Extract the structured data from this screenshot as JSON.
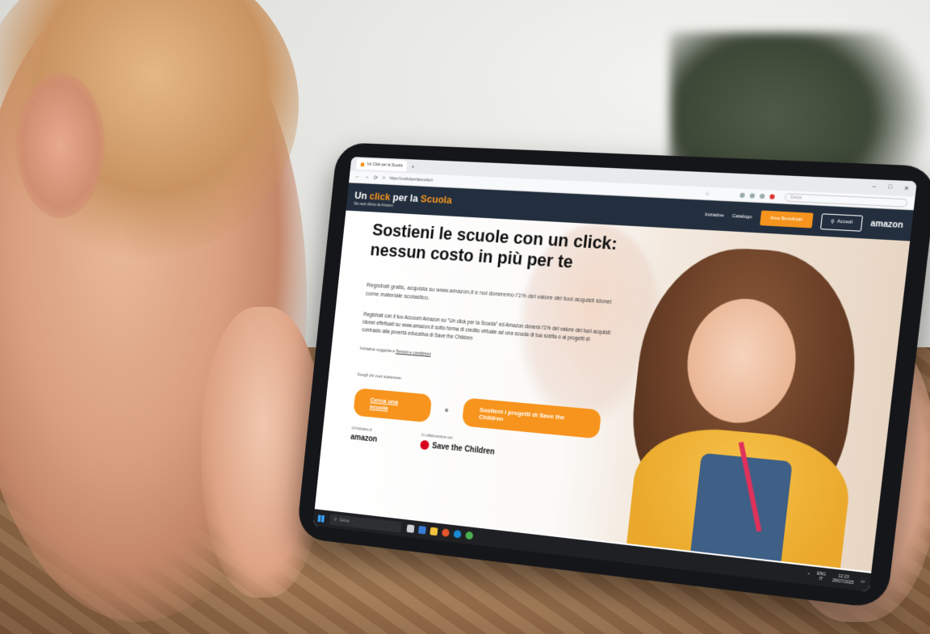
{
  "browser": {
    "tab_title": "Un Click per la Scuola",
    "tab_plus": "+",
    "url": "https://unclickperlascuola.it",
    "search_placeholder": "Cerca",
    "window_controls": [
      "–",
      "□",
      "✕"
    ]
  },
  "site": {
    "logo": {
      "part1": "Un ",
      "highlight": "click",
      "part2": " per la ",
      "part3": "Scuola",
      "tagline": "Sito web offerto da Amazon"
    },
    "nav": {
      "iniziative": "Iniziative",
      "catalogo": "Catalogo",
      "area_beneficiari": "Area Beneficiari",
      "accedi": "Accedi",
      "brand": "amazon"
    }
  },
  "hero": {
    "title": "Sostieni le scuole con un click: nessun costo in più per te",
    "intro": "Registrati gratis, acquista su www.amazon.it e noi doneremo l'1% del valore dei tuoi acquisti idonei come materiale scolastico.",
    "details": "Registrati con il tuo Account Amazon su \"Un click per la Scuola\" ed Amazon donerà l'1% del valore dei tuoi acquisti idonei effettuati su www.amazon.it sotto forma di credito virtuale ad una scuola di tua scelta o ai progetti di contrasto alla povertà educativa di Save the Children",
    "terms_prefix": "Iniziativa soggetta a ",
    "terms_link": "Termini e condizioni",
    "choose_label": "Scegli chi vuoi sostenere:",
    "cta_school": "Cerca una scuola",
    "or_label": "o",
    "cta_stc": "Sostieni i progetti di Save the Children",
    "partner1_label": "Un'iniziativa di",
    "partner1_name": "amazon",
    "partner2_label": "In collaborazione con",
    "partner2_name": "Save the Children"
  },
  "taskbar": {
    "search_placeholder": "Cerca",
    "lang": "ENG",
    "region": "IT",
    "time": "12:23",
    "date": "28/07/2025"
  },
  "colors": {
    "accent": "#f7941d",
    "header_bg": "#232f3e",
    "taskbar_bg": "#1f2023"
  }
}
